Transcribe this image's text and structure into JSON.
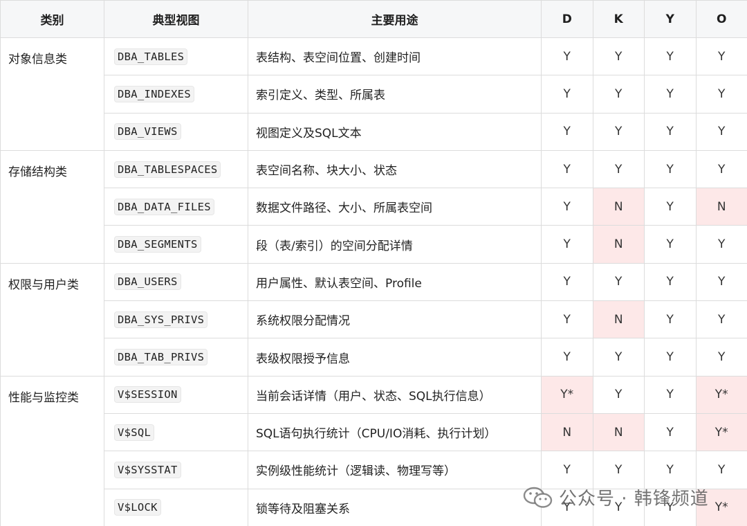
{
  "headers": [
    "类别",
    "典型视图",
    "主要用途",
    "D",
    "K",
    "Y",
    "O"
  ],
  "groups": [
    {
      "category": "对象信息类",
      "rows": [
        {
          "view": "DBA_TABLES",
          "use": "表结构、表空间位置、创建时间",
          "flags": [
            "Y",
            "Y",
            "Y",
            "Y"
          ],
          "hl": [
            false,
            false,
            false,
            false
          ]
        },
        {
          "view": "DBA_INDEXES",
          "use": "索引定义、类型、所属表",
          "flags": [
            "Y",
            "Y",
            "Y",
            "Y"
          ],
          "hl": [
            false,
            false,
            false,
            false
          ]
        },
        {
          "view": "DBA_VIEWS",
          "use": "视图定义及SQL文本",
          "flags": [
            "Y",
            "Y",
            "Y",
            "Y"
          ],
          "hl": [
            false,
            false,
            false,
            false
          ]
        }
      ]
    },
    {
      "category": "存储结构类",
      "rows": [
        {
          "view": "DBA_TABLESPACES",
          "use": "表空间名称、块大小、状态",
          "flags": [
            "Y",
            "Y",
            "Y",
            "Y"
          ],
          "hl": [
            false,
            false,
            false,
            false
          ]
        },
        {
          "view": "DBA_DATA_FILES",
          "use": "数据文件路径、大小、所属表空间",
          "flags": [
            "Y",
            "N",
            "Y",
            "N"
          ],
          "hl": [
            false,
            true,
            false,
            true
          ]
        },
        {
          "view": "DBA_SEGMENTS",
          "use": "段（表/索引）的空间分配详情",
          "flags": [
            "Y",
            "N",
            "Y",
            "Y"
          ],
          "hl": [
            false,
            true,
            false,
            false
          ]
        }
      ]
    },
    {
      "category": "权限与用户类",
      "rows": [
        {
          "view": "DBA_USERS",
          "use": "用户属性、默认表空间、Profile",
          "flags": [
            "Y",
            "Y",
            "Y",
            "Y"
          ],
          "hl": [
            false,
            false,
            false,
            false
          ]
        },
        {
          "view": "DBA_SYS_PRIVS",
          "use": "系统权限分配情况",
          "flags": [
            "Y",
            "N",
            "Y",
            "Y"
          ],
          "hl": [
            false,
            true,
            false,
            false
          ]
        },
        {
          "view": "DBA_TAB_PRIVS",
          "use": "表级权限授予信息",
          "flags": [
            "Y",
            "Y",
            "Y",
            "Y"
          ],
          "hl": [
            false,
            false,
            false,
            false
          ]
        }
      ]
    },
    {
      "category": "性能与监控类",
      "rows": [
        {
          "view": "V$SESSION",
          "use": "当前会话详情（用户、状态、SQL执行信息）",
          "flags": [
            "Y*",
            "Y",
            "Y",
            "Y*"
          ],
          "hl": [
            true,
            false,
            false,
            true
          ]
        },
        {
          "view": "V$SQL",
          "use": "SQL语句执行统计（CPU/IO消耗、执行计划）",
          "flags": [
            "N",
            "N",
            "Y",
            "Y*"
          ],
          "hl": [
            true,
            true,
            false,
            true
          ]
        },
        {
          "view": "V$SYSSTAT",
          "use": "实例级性能统计（逻辑读、物理写等）",
          "flags": [
            "Y",
            "Y",
            "Y",
            "Y"
          ],
          "hl": [
            false,
            false,
            false,
            false
          ]
        },
        {
          "view": "V$LOCK",
          "use": "锁等待及阻塞关系",
          "flags": [
            "Y",
            "Y",
            "Y",
            "Y*"
          ],
          "hl": [
            false,
            false,
            false,
            true
          ]
        }
      ]
    }
  ],
  "watermark": {
    "text": "公众号 · 韩锋频道",
    "icon": "wechat-icon"
  }
}
